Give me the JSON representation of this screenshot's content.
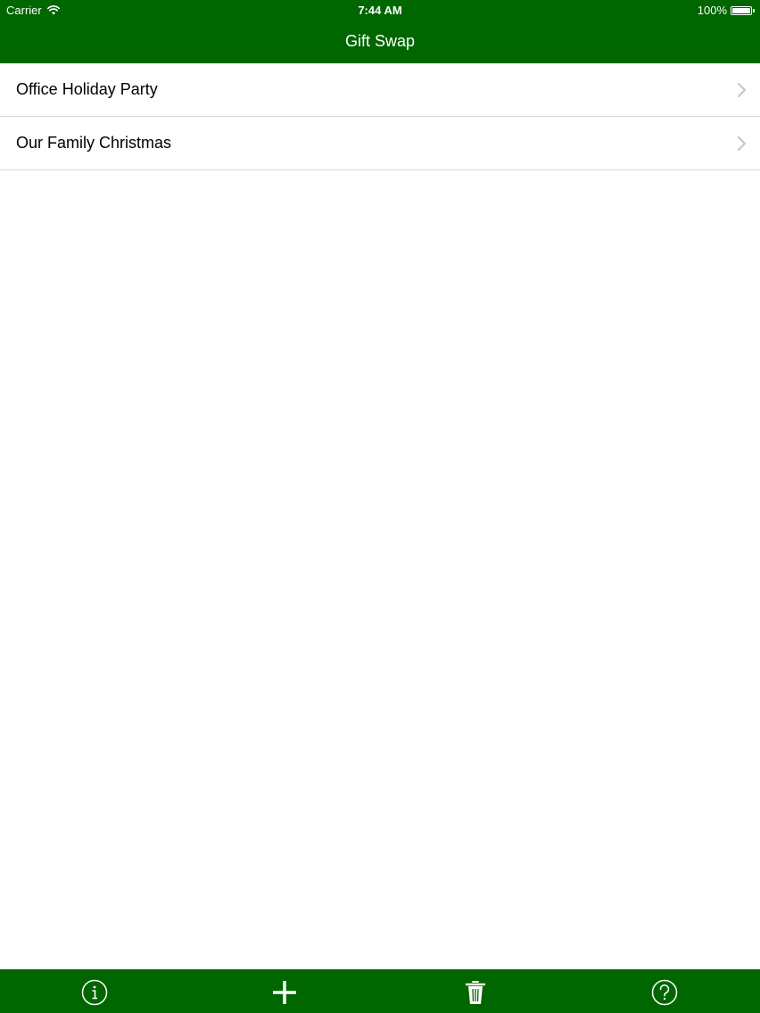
{
  "status_bar": {
    "carrier": "Carrier",
    "time": "7:44 AM",
    "battery_percent": "100%",
    "battery_level": 1.0
  },
  "nav": {
    "title": "Gift Swap"
  },
  "list": {
    "items": [
      {
        "label": "Office Holiday Party"
      },
      {
        "label": "Our Family Christmas"
      }
    ]
  },
  "toolbar": {
    "buttons": [
      {
        "icon": "info-icon"
      },
      {
        "icon": "plus-icon"
      },
      {
        "icon": "trash-icon"
      },
      {
        "icon": "help-icon"
      }
    ]
  },
  "colors": {
    "bar_green": "#006600",
    "separator": "#d9d9d9",
    "chevron": "#c7c7cc"
  }
}
